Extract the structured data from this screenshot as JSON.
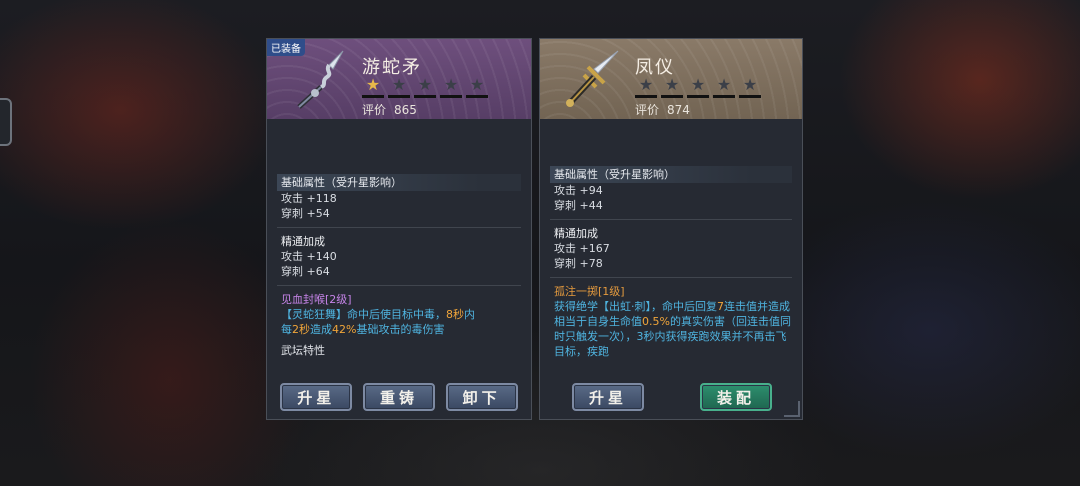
{
  "left_card": {
    "badge": "已装备",
    "name": "游蛇矛",
    "stars_total": 5,
    "stars_filled": 1,
    "rating_label": "评价",
    "rating_value": "865",
    "base_title": "基础属性（受升星影响）",
    "base_attack": "攻击 +118",
    "base_pierce": "穿刺 +54",
    "mastery_title": "精通加成",
    "mastery_attack": "攻击 +140",
    "mastery_pierce": "穿刺 +64",
    "skill_title": "见血封喉[2级]",
    "skill_desc_a": "【灵蛇狂舞】命中后使目标中毒，",
    "skill_hl_1": "8秒",
    "skill_desc_b": "内",
    "skill_desc_c": "每",
    "skill_hl_2": "2秒",
    "skill_desc_d": "造成",
    "skill_hl_3": "42%",
    "skill_desc_e": "基础攻击的毒伤害",
    "feature_title": "武坛特性",
    "buttons": [
      "升星",
      "重铸",
      "卸下"
    ]
  },
  "right_card": {
    "name": "凤仪",
    "stars_total": 5,
    "stars_filled": 0,
    "rating_label": "评价",
    "rating_value": "874",
    "base_title": "基础属性（受升星影响）",
    "base_attack": "攻击 +94",
    "base_pierce": "穿刺 +44",
    "mastery_title": "精通加成",
    "mastery_attack": "攻击 +167",
    "mastery_pierce": "穿刺 +78",
    "skill_title": "孤注一掷[1级]",
    "skill_desc_a": "获得绝学【出虹·刺】，命中后回复",
    "skill_hl_1": "7",
    "skill_desc_b": "连击值并造成相当于自身生命值",
    "skill_hl_2": "0.5%",
    "skill_desc_c": "的真实伤害（回连击值同时只触发一次），3秒内获得疾跑效果并不再击飞目标，疾跑",
    "buttons": [
      "升星",
      "装配"
    ]
  },
  "colors": {
    "left_header": "#6e4f7d",
    "right_header": "#8a7a68",
    "star_on": "#e7b94a",
    "skill_blue": "#4fb4e0",
    "highlight": "#f0a53a",
    "green_button": "#2d8f6e"
  }
}
